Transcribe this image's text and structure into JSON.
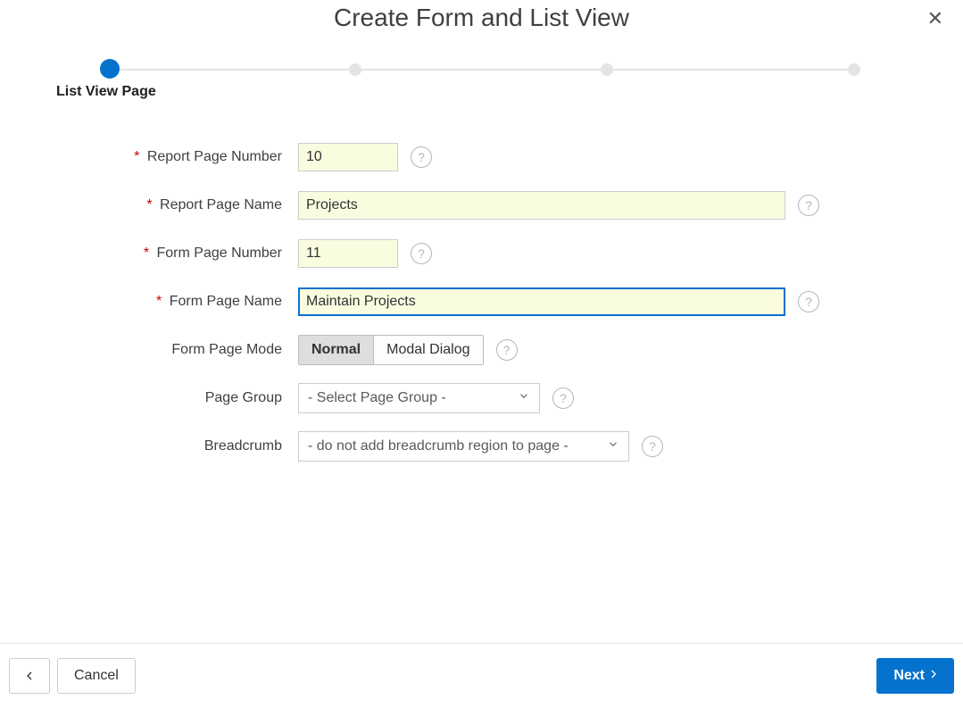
{
  "header": {
    "title": "Create Form and List View"
  },
  "wizard": {
    "active_step": 0,
    "steps": [
      {
        "label": "List View Page"
      },
      {
        "label": ""
      },
      {
        "label": ""
      },
      {
        "label": ""
      }
    ]
  },
  "form": {
    "report_page_number": {
      "label": "Report Page Number",
      "value": "10",
      "required": true
    },
    "report_page_name": {
      "label": "Report Page Name",
      "value": "Projects",
      "required": true
    },
    "form_page_number": {
      "label": "Form Page Number",
      "value": "11",
      "required": true
    },
    "form_page_name": {
      "label": "Form Page Name",
      "value": "Maintain Projects",
      "required": true
    },
    "form_page_mode": {
      "label": "Form Page Mode",
      "options": [
        "Normal",
        "Modal Dialog"
      ],
      "selected": "Normal"
    },
    "page_group": {
      "label": "Page Group",
      "selected": "- Select Page Group -"
    },
    "breadcrumb": {
      "label": "Breadcrumb",
      "selected": "- do not add breadcrumb region to page -"
    }
  },
  "footer": {
    "cancel": "Cancel",
    "next": "Next"
  },
  "colors": {
    "primary": "#0572CE",
    "highlight_bg": "#fafce0"
  }
}
